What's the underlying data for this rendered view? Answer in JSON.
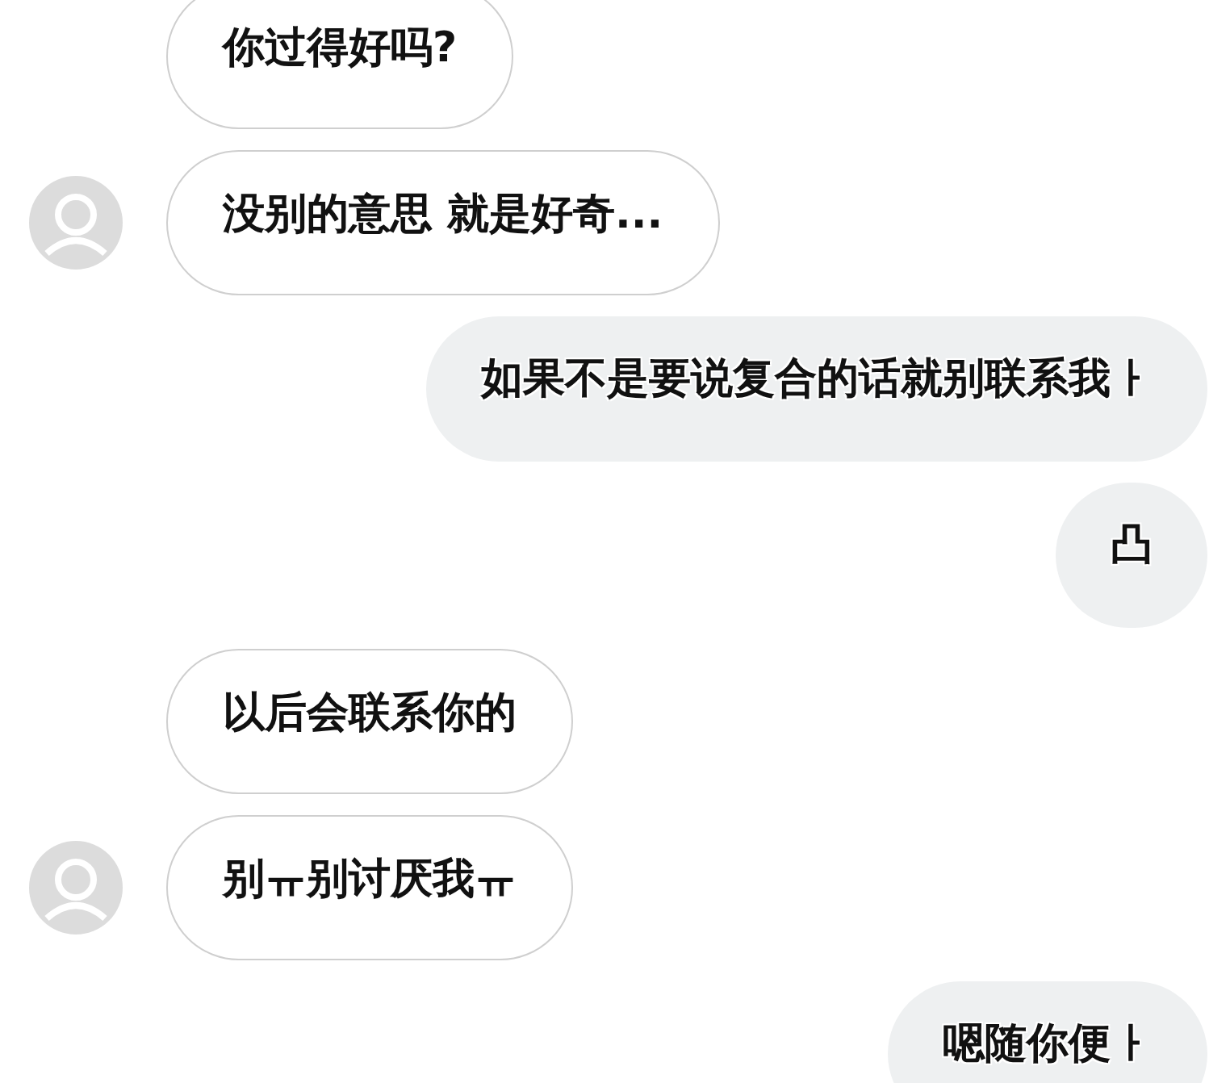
{
  "messages": [
    {
      "kind": "received",
      "avatar": false,
      "text": "你过得好吗?"
    },
    {
      "kind": "received",
      "avatar": true,
      "text": "没别的意思 就是好奇..."
    },
    {
      "kind": "sent",
      "text": "如果不是要说复合的话就别联系我ㅏ"
    },
    {
      "kind": "sent",
      "text": "凸"
    },
    {
      "kind": "received",
      "avatar": false,
      "text": "以后会联系你的"
    },
    {
      "kind": "received",
      "avatar": true,
      "text": "别ㅠ别讨厌我ㅠ"
    },
    {
      "kind": "sent",
      "text": "嗯随你便ㅏ"
    }
  ]
}
